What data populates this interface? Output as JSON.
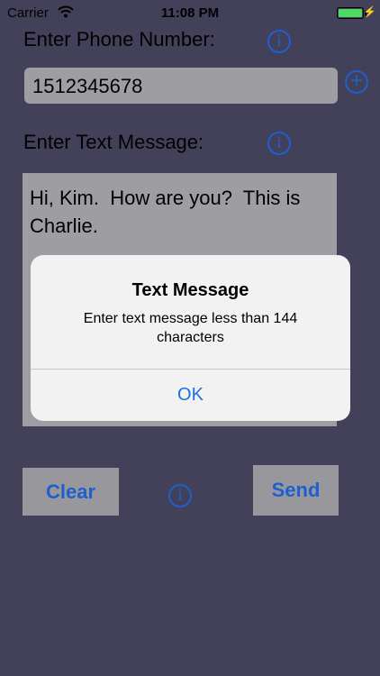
{
  "status_bar": {
    "carrier": "Carrier",
    "time": "11:08 PM"
  },
  "phone": {
    "label": "Enter Phone Number:",
    "value": "1512345678"
  },
  "message": {
    "label": "Enter Text Message:",
    "text": "Hi, Kim.  How are you?  This is\nCharlie."
  },
  "buttons": {
    "clear": "Clear",
    "send": "Send"
  },
  "icons": {
    "info": "i",
    "add": "+"
  },
  "alert": {
    "title": "Text Message",
    "message": "Enter text message less than 144 characters",
    "ok": "OK"
  },
  "colors": {
    "background": "#43405a",
    "accent": "#1e5fd0",
    "field": "#9e9ea2",
    "battery": "#4cd964"
  }
}
